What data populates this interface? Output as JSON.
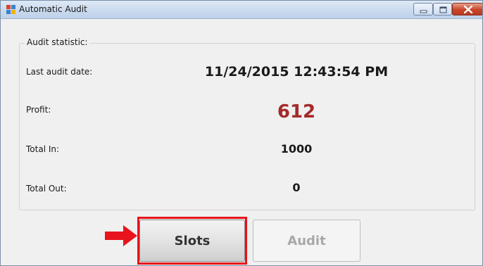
{
  "window": {
    "title": "Automatic Audit",
    "controls": [
      "minimize",
      "maximize",
      "close"
    ]
  },
  "audit_statistic": {
    "group_title": "Audit statistic:",
    "rows": [
      {
        "label": "Last audit date:",
        "value": "11/24/2015 12:43:54 PM"
      },
      {
        "label": "Profit:",
        "value": "612",
        "value_color": "#a52a2a"
      },
      {
        "label": "Total In:",
        "value": "1000"
      },
      {
        "label": "Total Out:",
        "value": "0"
      }
    ]
  },
  "buttons": {
    "slots": {
      "label": "Slots",
      "state": "enabled",
      "highlighted": true
    },
    "audit": {
      "label": "Audit",
      "state": "disabled"
    }
  },
  "annotation": {
    "arrow_color": "#e8131b",
    "box_color": "#e8131b"
  }
}
